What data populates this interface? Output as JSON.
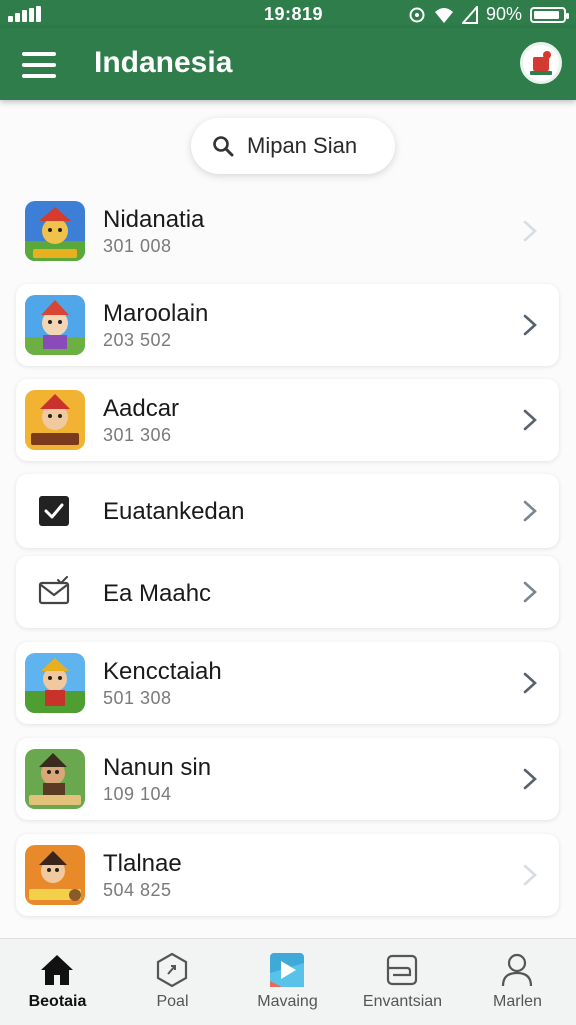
{
  "status_bar": {
    "time": "19:819",
    "battery": "90%",
    "battery_fraction": 0.9
  },
  "app_bar": {
    "title": "Indanesia"
  },
  "search": {
    "label": "Mipan Sian"
  },
  "list": {
    "items": [
      {
        "title": "Nidanatia",
        "subtitle": "301 008",
        "icon": "game-character-thumbnail"
      },
      {
        "title": "Maroolain",
        "subtitle": "203 502",
        "icon": "game-character-thumbnail"
      },
      {
        "title": "Aadcar",
        "subtitle": "301 306",
        "icon": "game-character-thumbnail"
      },
      {
        "title": "Euatankedan",
        "icon": "checkbox-checked-icon"
      },
      {
        "title": "Ea Maahc",
        "icon": "envelope-check-icon"
      },
      {
        "title": "Kencctaiah",
        "subtitle": "501 308",
        "icon": "game-character-thumbnail"
      },
      {
        "title": "Nanun sin",
        "subtitle": "109 104",
        "icon": "game-character-thumbnail"
      },
      {
        "title": "Tlalnae",
        "subtitle": "504 825",
        "icon": "game-character-thumbnail"
      }
    ]
  },
  "bottom_nav": {
    "items": [
      {
        "label": "Beotaia",
        "icon": "home-icon",
        "active": true
      },
      {
        "label": "Poal",
        "icon": "hexagon-icon"
      },
      {
        "label": "Mavaing",
        "icon": "play-icon"
      },
      {
        "label": "Envantsian",
        "icon": "wallet-icon"
      },
      {
        "label": "Marlen",
        "icon": "user-icon"
      }
    ]
  },
  "colors": {
    "primary": "#2e7d4a",
    "background": "#fbfbfb",
    "card": "#ffffff",
    "chevron": "#56636e"
  }
}
